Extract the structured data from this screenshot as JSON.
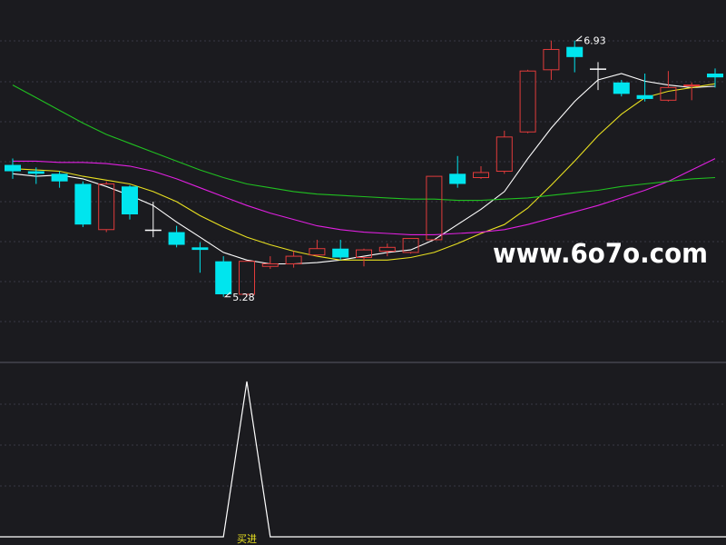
{
  "chart_data": {
    "type": "candlestick",
    "price_min": 4.4,
    "price_max": 7.25,
    "candles": [
      {
        "open": 5.95,
        "high": 6.0,
        "low": 5.84,
        "close": 5.9,
        "color": "#00e5ee"
      },
      {
        "open": 5.9,
        "high": 5.93,
        "low": 5.8,
        "close": 5.88,
        "color": "#00e5ee"
      },
      {
        "open": 5.88,
        "high": 5.9,
        "low": 5.77,
        "close": 5.82,
        "color": "#00e5ee"
      },
      {
        "open": 5.8,
        "high": 5.82,
        "low": 5.46,
        "close": 5.48,
        "color": "#00e5ee"
      },
      {
        "open": 5.44,
        "high": 5.82,
        "low": 5.42,
        "close": 5.8,
        "color": "#e23b3b"
      },
      {
        "open": 5.78,
        "high": 5.79,
        "low": 5.52,
        "close": 5.56,
        "color": "#00e5ee"
      },
      {
        "open": 5.44,
        "high": 5.66,
        "low": 5.38,
        "close": 5.44,
        "color": "#ffffff"
      },
      {
        "open": 5.42,
        "high": 5.47,
        "low": 5.3,
        "close": 5.32,
        "color": "#00e5ee"
      },
      {
        "open": 5.3,
        "high": 5.34,
        "low": 5.1,
        "close": 5.28,
        "color": "#00e5ee"
      },
      {
        "open": 5.19,
        "high": 5.23,
        "low": 4.91,
        "close": 4.93,
        "color": "#00e5ee"
      },
      {
        "open": 4.93,
        "high": 5.19,
        "low": 4.91,
        "close": 5.19,
        "color": "#e23b3b"
      },
      {
        "open": 5.15,
        "high": 5.23,
        "low": 5.13,
        "close": 5.17,
        "color": "#e23b3b"
      },
      {
        "open": 5.17,
        "high": 5.27,
        "low": 5.14,
        "close": 5.23,
        "color": "#e23b3b"
      },
      {
        "open": 5.24,
        "high": 5.36,
        "low": 5.23,
        "close": 5.29,
        "color": "#e23b3b"
      },
      {
        "open": 5.29,
        "high": 5.36,
        "low": 5.2,
        "close": 5.22,
        "color": "#00e5ee"
      },
      {
        "open": 5.22,
        "high": 5.29,
        "low": 5.15,
        "close": 5.28,
        "color": "#e23b3b"
      },
      {
        "open": 5.27,
        "high": 5.33,
        "low": 5.23,
        "close": 5.3,
        "color": "#e23b3b"
      },
      {
        "open": 5.26,
        "high": 5.37,
        "low": 5.25,
        "close": 5.37,
        "color": "#e23b3b"
      },
      {
        "open": 5.36,
        "high": 5.86,
        "low": 5.36,
        "close": 5.86,
        "color": "#e23b3b"
      },
      {
        "open": 5.88,
        "high": 6.02,
        "low": 5.77,
        "close": 5.8,
        "color": "#00e5ee"
      },
      {
        "open": 5.85,
        "high": 5.94,
        "low": 5.84,
        "close": 5.89,
        "color": "#e23b3b"
      },
      {
        "open": 5.9,
        "high": 6.22,
        "low": 5.88,
        "close": 6.17,
        "color": "#e23b3b"
      },
      {
        "open": 6.21,
        "high": 6.7,
        "low": 6.2,
        "close": 6.69,
        "color": "#e23b3b"
      },
      {
        "open": 6.7,
        "high": 6.93,
        "low": 6.62,
        "close": 6.86,
        "color": "#e23b3b"
      },
      {
        "open": 6.88,
        "high": 6.93,
        "low": 6.68,
        "close": 6.8,
        "color": "#00e5ee"
      },
      {
        "open": 6.71,
        "high": 6.76,
        "low": 6.54,
        "close": 6.71,
        "color": "#ffffff"
      },
      {
        "open": 6.6,
        "high": 6.62,
        "low": 6.49,
        "close": 6.51,
        "color": "#00e5ee"
      },
      {
        "open": 6.5,
        "high": 6.67,
        "low": 6.45,
        "close": 6.47,
        "color": "#00e5ee"
      },
      {
        "open": 6.46,
        "high": 6.69,
        "low": 6.45,
        "close": 6.56,
        "color": "#e23b3b"
      },
      {
        "open": 6.58,
        "high": 6.6,
        "low": 6.46,
        "close": 6.58,
        "color": "#e23b3b"
      },
      {
        "open": 6.64,
        "high": 6.71,
        "low": 6.56,
        "close": 6.67,
        "color": "#00e5ee"
      }
    ],
    "moving_averages": [
      {
        "color": "#ffffff",
        "values": [
          5.88,
          5.86,
          5.87,
          5.84,
          5.78,
          5.71,
          5.63,
          5.5,
          5.38,
          5.26,
          5.2,
          5.17,
          5.17,
          5.18,
          5.2,
          5.23,
          5.26,
          5.28,
          5.36,
          5.48,
          5.6,
          5.74,
          6.0,
          6.24,
          6.45,
          6.62,
          6.67,
          6.61,
          6.58,
          6.56,
          6.57
        ]
      },
      {
        "color": "#e8e020",
        "values": [
          5.92,
          5.91,
          5.9,
          5.86,
          5.83,
          5.8,
          5.74,
          5.66,
          5.55,
          5.46,
          5.38,
          5.32,
          5.27,
          5.23,
          5.2,
          5.2,
          5.2,
          5.22,
          5.26,
          5.33,
          5.41,
          5.48,
          5.61,
          5.79,
          5.98,
          6.18,
          6.35,
          6.48,
          6.53,
          6.56,
          6.59
        ]
      },
      {
        "color": "#e020e0",
        "values": [
          5.98,
          5.98,
          5.97,
          5.97,
          5.96,
          5.94,
          5.9,
          5.84,
          5.77,
          5.7,
          5.63,
          5.57,
          5.52,
          5.47,
          5.44,
          5.42,
          5.41,
          5.4,
          5.4,
          5.41,
          5.42,
          5.44,
          5.48,
          5.53,
          5.58,
          5.63,
          5.69,
          5.75,
          5.82,
          5.91,
          6.0
        ]
      },
      {
        "color": "#20c020",
        "values": [
          6.58,
          6.48,
          6.38,
          6.28,
          6.19,
          6.12,
          6.05,
          5.98,
          5.91,
          5.85,
          5.8,
          5.77,
          5.74,
          5.72,
          5.71,
          5.7,
          5.69,
          5.68,
          5.68,
          5.67,
          5.67,
          5.68,
          5.69,
          5.71,
          5.73,
          5.75,
          5.78,
          5.8,
          5.82,
          5.84,
          5.85
        ]
      }
    ],
    "annotations": [
      {
        "label": "5.28",
        "candle_index": 9,
        "price": 4.91
      },
      {
        "label": "6.93",
        "candle_index": 24,
        "price": 6.93
      }
    ],
    "indicator": {
      "values": [
        0,
        0,
        0,
        0,
        0,
        0,
        0,
        0,
        0,
        0,
        1,
        0,
        0,
        0,
        0,
        0,
        0,
        0,
        0,
        0,
        0,
        0,
        0,
        0,
        0,
        0,
        0,
        0,
        0,
        0,
        0
      ],
      "signal_label": "买进",
      "signal_index": 10
    }
  },
  "watermark": {
    "text": "www.6o7o.com",
    "color": "#ffffff"
  },
  "colors": {
    "background": "#1b1b1f",
    "grid": "#3a3a44",
    "divider": "#5a5a66",
    "up": "#e23b3b",
    "down": "#00e5ee",
    "signal_label": "#e8e020",
    "indicator_line": "#ffffff"
  }
}
